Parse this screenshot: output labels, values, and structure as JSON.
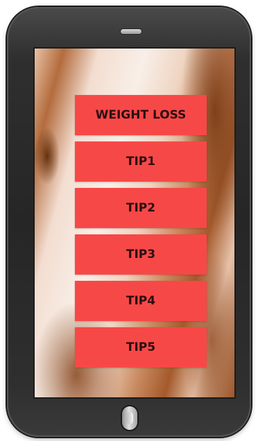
{
  "menu": {
    "items": [
      {
        "label": "WEIGHT LOSS"
      },
      {
        "label": "TIP1"
      },
      {
        "label": "TIP2"
      },
      {
        "label": "TIP3"
      },
      {
        "label": "TIP4"
      },
      {
        "label": "TIP5"
      }
    ],
    "button_color": "#f74848",
    "text_color": "#2a0f0f"
  },
  "device": {
    "frame_color": "#2b2b2b",
    "speaker_icon": "speaker-grille",
    "home_icon": "home-button"
  }
}
